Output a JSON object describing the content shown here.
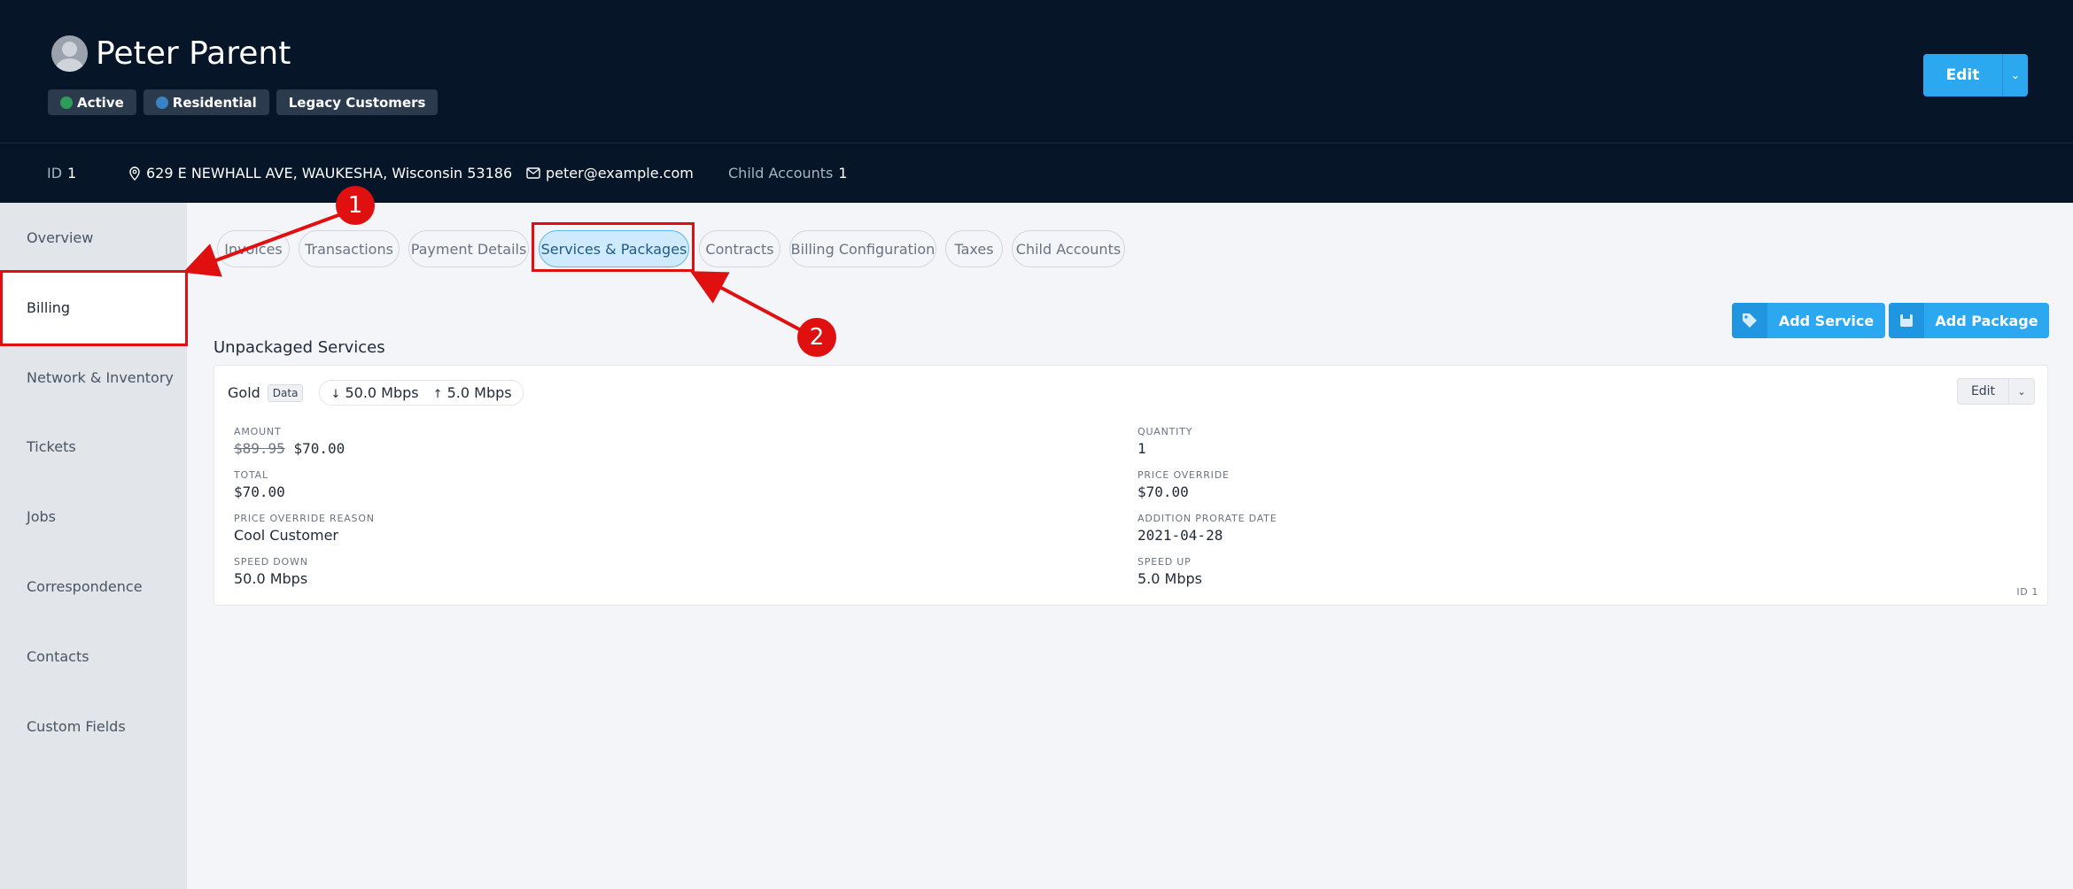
{
  "header": {
    "customer_name": "Peter Parent",
    "badges": [
      {
        "label": "Active",
        "dot_color": "#2e9d5a"
      },
      {
        "label": "Residential",
        "dot_color": "#3b82c4"
      },
      {
        "label": "Legacy Customers"
      }
    ],
    "edit_label": "Edit"
  },
  "infobar": {
    "id_label": "ID",
    "id_value": "1",
    "address": "629 E NEWHALL AVE, WAUKESHA, Wisconsin 53186",
    "email": "peter@example.com",
    "child_accounts_label": "Child Accounts",
    "child_accounts_value": "1"
  },
  "sidebar": {
    "items": [
      {
        "label": "Overview"
      },
      {
        "label": "Billing",
        "active": true
      },
      {
        "label": "Network & Inventory"
      },
      {
        "label": "Tickets"
      },
      {
        "label": "Jobs"
      },
      {
        "label": "Correspondence"
      },
      {
        "label": "Contacts"
      },
      {
        "label": "Custom Fields"
      }
    ]
  },
  "tabs": [
    {
      "label": "Invoices"
    },
    {
      "label": "Transactions"
    },
    {
      "label": "Payment Details"
    },
    {
      "label": "Services & Packages",
      "active": true
    },
    {
      "label": "Contracts"
    },
    {
      "label": "Billing Configuration"
    },
    {
      "label": "Taxes"
    },
    {
      "label": "Child Accounts"
    }
  ],
  "actions": {
    "add_service_label": "Add Service",
    "add_package_label": "Add Package"
  },
  "section_title": "Unpackaged Services",
  "service": {
    "name": "Gold",
    "type_badge": "Data",
    "speed_down": "50.0 Mbps",
    "speed_up": "5.0 Mbps",
    "edit_label": "Edit",
    "fields": {
      "amount_label": "AMOUNT",
      "amount_original": "$89.95",
      "amount_value": "$70.00",
      "quantity_label": "QUANTITY",
      "quantity_value": "1",
      "total_label": "TOTAL",
      "total_value": "$70.00",
      "price_override_label": "PRICE OVERRIDE",
      "price_override_value": "$70.00",
      "price_override_reason_label": "PRICE OVERRIDE REASON",
      "price_override_reason_value": "Cool Customer",
      "addition_prorate_date_label": "ADDITION PRORATE DATE",
      "addition_prorate_date_value": "2021-04-28",
      "speed_down_label": "SPEED DOWN",
      "speed_down_value": "50.0 Mbps",
      "speed_up_label": "SPEED UP",
      "speed_up_value": "5.0 Mbps"
    },
    "id_text": "ID 1"
  },
  "annotations": {
    "marker_1": "1",
    "marker_2": "2",
    "color": "#e01010"
  }
}
